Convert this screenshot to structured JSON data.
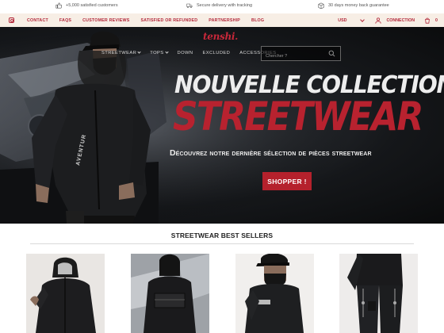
{
  "info_bar": {
    "items": [
      {
        "icon": "thumbs-up-icon",
        "text": "+5,000 satisfied customers"
      },
      {
        "icon": "delivery-truck-icon",
        "text": "Secure delivery with tracking"
      },
      {
        "icon": "return-box-icon",
        "text": "30 days money back guarantee"
      }
    ]
  },
  "secondary_nav": {
    "links": [
      "CONTACT",
      "FAQS",
      "CUSTOMER REVIEWS",
      "SATISFIED OR REFUNDED",
      "PARTNERSHIP",
      "BLOG"
    ],
    "currency": "USD",
    "connection": "CONNECTION",
    "cart_count": "0"
  },
  "header": {
    "logo": "tenshi.",
    "nav": [
      "STREETWEAR",
      "TOPS",
      "DOWN",
      "EXCLUDED",
      "ACCESSORIES"
    ],
    "search_placeholder": "Chercher ?"
  },
  "hero": {
    "headline_top": "NOUVELLE COLLECTION",
    "headline_main": "STREETWEAR",
    "subline": "Découvrez notre dernière sélection de pièces streetwear",
    "cta": "SHOPPER !"
  },
  "best_sellers": {
    "title": "STREETWEAR BEST SELLERS"
  },
  "colors": {
    "accent": "#b5212c",
    "secondary_bar": "#f7eee5",
    "hero_dark": "#15171a"
  }
}
